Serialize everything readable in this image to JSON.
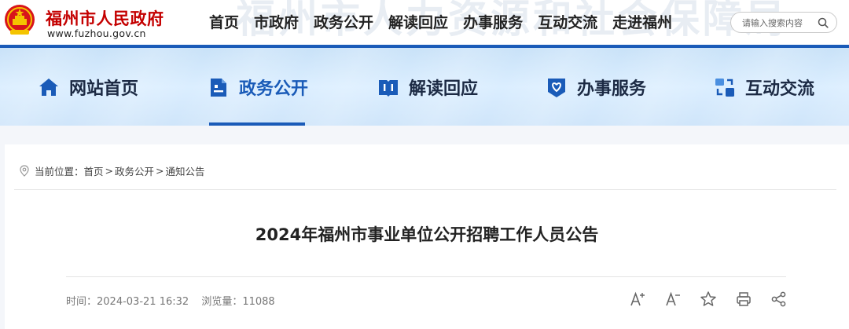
{
  "header": {
    "site_name": "福州市人民政府",
    "site_url": "www.fuzhou.gov.cn",
    "watermark": "福州市人力资源和社会保障局",
    "top_nav": [
      "首页",
      "市政府",
      "政务公开",
      "解读回应",
      "办事服务",
      "互动交流",
      "走进福州"
    ],
    "search": {
      "placeholder": "请输入搜索内容",
      "icon": "search-icon"
    }
  },
  "main_nav": {
    "items": [
      {
        "label": "网站首页",
        "icon": "home-icon"
      },
      {
        "label": "政务公开",
        "icon": "document-icon",
        "active": true
      },
      {
        "label": "解读回应",
        "icon": "book-icon"
      },
      {
        "label": "办事服务",
        "icon": "heart-shield-icon"
      },
      {
        "label": "互动交流",
        "icon": "exchange-icon"
      }
    ]
  },
  "breadcrumb": {
    "prefix": "当前位置：",
    "items": [
      "首页",
      "政务公开",
      "通知公告"
    ],
    "separator": ">"
  },
  "article": {
    "title": "2024年福州市事业单位公开招聘工作人员公告",
    "time_label": "时间：",
    "time": "2024-03-21 16:32",
    "views_label": "浏览量：",
    "views": "11088"
  },
  "tools": {
    "font_increase": "A+",
    "font_decrease": "A-",
    "favorite": "star-icon",
    "print": "printer-icon",
    "share": "share-icon"
  },
  "colors": {
    "brand_red": "#c40000",
    "brand_blue": "#1a5bb8",
    "nav_bg": "#d3e8fb"
  }
}
